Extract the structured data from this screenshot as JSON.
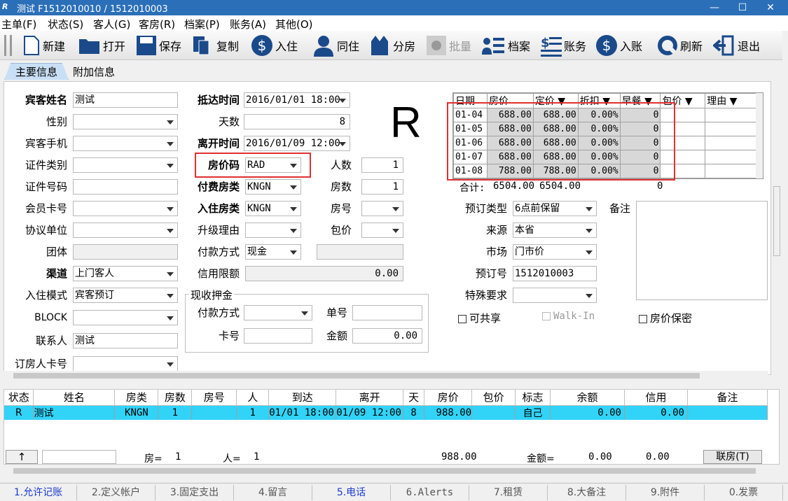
{
  "window": {
    "title": "测试  F1512010010  /  1512010003",
    "logo": "R"
  },
  "menu": [
    "主单(F)",
    "状态(S)",
    "客人(G)",
    "客房(R)",
    "档案(P)",
    "账务(A)",
    "其他(O)"
  ],
  "toolbar": {
    "new": "新建",
    "open": "打开",
    "save": "保存",
    "copy": "复制",
    "checkin": "入住",
    "share": "同住",
    "split": "分房",
    "batch": "批量",
    "profile": "档案",
    "account": "账务",
    "post": "入账",
    "refresh": "刷新",
    "exit": "退出"
  },
  "tabs": {
    "main": "主要信息",
    "extra": "附加信息"
  },
  "form": {
    "guest_name_label": "宾客姓名",
    "guest_name": "测试",
    "gender_label": "性别",
    "mobile_label": "宾客手机",
    "idtype_label": "证件类别",
    "idno_label": "证件号码",
    "member_label": "会员卡号",
    "agreement_label": "协议单位",
    "group_label": "团体",
    "channel_label": "渠道",
    "channel": "上门客人",
    "mode_label": "入住模式",
    "mode": "宾客预订",
    "block_label": "BLOCK",
    "contact_label": "联系人",
    "contact": "测试",
    "booker_label": "订房人卡号",
    "arrive_label": "抵达时间",
    "arrive": "2016/01/01 18:00",
    "days_label": "天数",
    "days": "8",
    "depart_label": "离开时间",
    "depart": "2016/01/09 12:00",
    "ratecode_label": "房价码",
    "ratecode": "RAD",
    "paytype_label": "付费房类",
    "paytype": "KNGN",
    "roomtype_label": "入住房类",
    "roomtype": "KNGN",
    "upgrade_label": "升级理由",
    "payment_label": "付款方式",
    "payment": "现金",
    "credit_label": "信用限额",
    "credit": "0.00",
    "persons_label": "人数",
    "persons": "1",
    "rooms_label": "房数",
    "rooms": "1",
    "roomno_label": "房号",
    "package_label": "包价",
    "deposit_title": "现收押金",
    "dep_pay_label": "付款方式",
    "dep_no_label": "单号",
    "dep_card_label": "卡号",
    "dep_amount_label": "金额",
    "dep_amount": "0.00",
    "status_letter": "R",
    "resv_type_label": "预订类型",
    "resv_type": "6点前保留",
    "source_label": "来源",
    "source": "本省",
    "market_label": "市场",
    "market": "门市价",
    "resv_no_label": "预订号",
    "resv_no": "1512010003",
    "special_label": "特殊要求",
    "remark_label": "备注",
    "share_label": "可共享",
    "walkin_label": "Walk-In",
    "secret_label": "房价保密"
  },
  "rate_table": {
    "headers": [
      "日期",
      "房价",
      "定价",
      "折扣",
      "早餐",
      "包价",
      "理由"
    ],
    "rows": [
      [
        "01-04",
        "688.00",
        "688.00",
        "0.00%",
        "0"
      ],
      [
        "01-05",
        "688.00",
        "688.00",
        "0.00%",
        "0"
      ],
      [
        "01-06",
        "688.00",
        "688.00",
        "0.00%",
        "0"
      ],
      [
        "01-07",
        "688.00",
        "688.00",
        "0.00%",
        "0"
      ],
      [
        "01-08",
        "788.00",
        "788.00",
        "0.00%",
        "0"
      ]
    ],
    "total_label": "合计:",
    "total1": "6504.00",
    "total2": "6504.00",
    "total_bf": "0"
  },
  "grid": {
    "headers": [
      "状态",
      "姓名",
      "房类",
      "房数",
      "房号",
      "人",
      "到达",
      "离开",
      "天",
      "房价",
      "包价",
      "标志",
      "余额",
      "信用",
      "备注"
    ],
    "row": [
      "R",
      "测试",
      "KNGN",
      "1",
      "",
      "1",
      "01/01 18:00",
      "01/09 12:00",
      "8",
      "988.00",
      "",
      "自己",
      "0.00",
      "0.00",
      ""
    ]
  },
  "footer": {
    "up": "↑",
    "room_label": "房=",
    "room_val": "1",
    "person_label": "人=",
    "person_val": "1",
    "price_total": "988.00",
    "amount_label": "金额=",
    "amount": "0.00",
    "credit": "0.00",
    "joint": "联房(T)"
  },
  "bottom_tabs": [
    "1.允许记账",
    "2.定义帐户",
    "3.固定支出",
    "4.留言",
    "5.电话",
    "6.Alerts",
    "7.租赁",
    "8.大备注",
    "9.附件",
    "0.发票"
  ]
}
